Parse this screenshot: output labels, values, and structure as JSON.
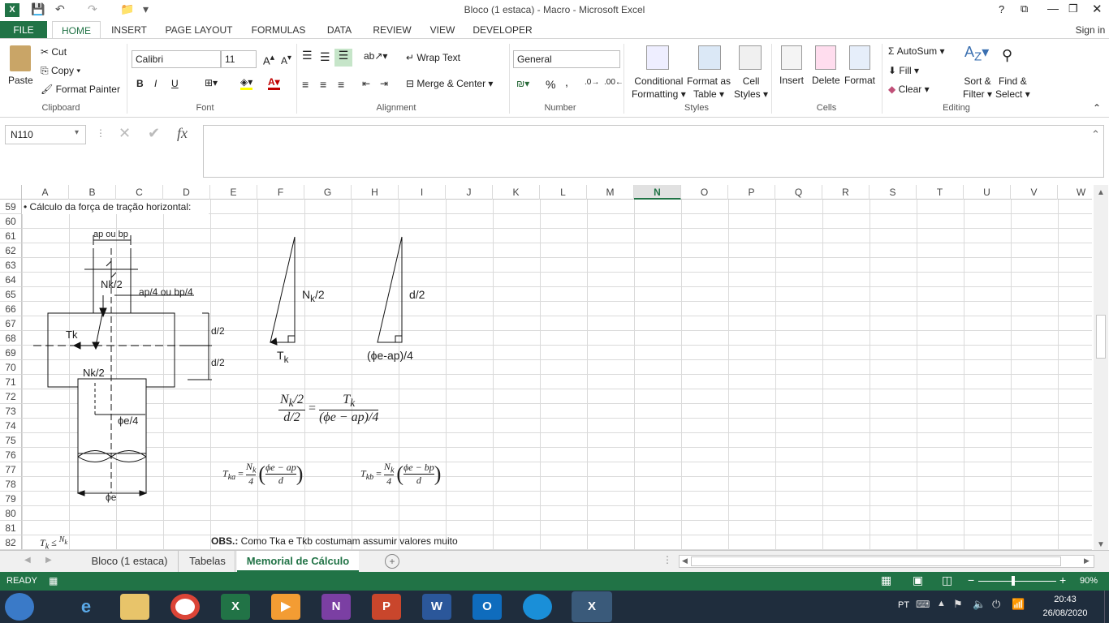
{
  "window": {
    "title": "Bloco (1 estaca) - Macro - Microsoft Excel",
    "sign_in": "Sign in"
  },
  "tabs": [
    "FILE",
    "HOME",
    "INSERT",
    "PAGE LAYOUT",
    "FORMULAS",
    "DATA",
    "REVIEW",
    "VIEW",
    "DEVELOPER"
  ],
  "clipboard": {
    "paste": "Paste",
    "cut": "Cut",
    "copy": "Copy",
    "format_painter": "Format Painter",
    "label": "Clipboard"
  },
  "font": {
    "name": "Calibri",
    "size": "11",
    "label": "Font",
    "bold": "B",
    "italic": "I",
    "underline": "U"
  },
  "alignment": {
    "wrap": "Wrap Text",
    "merge": "Merge & Center",
    "label": "Alignment"
  },
  "number": {
    "format": "General",
    "percent": "%",
    "comma": ",",
    "label": "Number"
  },
  "styles": {
    "conditional": "Conditional",
    "formatting": "Formatting",
    "format_as": "Format as",
    "table": "Table",
    "cell": "Cell",
    "styles": "Styles",
    "label": "Styles"
  },
  "cells": {
    "insert": "Insert",
    "delete": "Delete",
    "format": "Format",
    "label": "Cells"
  },
  "editing": {
    "autosum": "AutoSum",
    "fill": "Fill",
    "clear": "Clear",
    "sort": "Sort &",
    "filter": "Filter",
    "find": "Find &",
    "select": "Select",
    "label": "Editing"
  },
  "formula_bar": {
    "name_box": "N110",
    "fx": "fx"
  },
  "columns": [
    "A",
    "B",
    "C",
    "D",
    "E",
    "F",
    "G",
    "H",
    "I",
    "J",
    "K",
    "L",
    "M",
    "N",
    "O",
    "P",
    "Q",
    "R",
    "S",
    "T",
    "U",
    "V",
    "W"
  ],
  "selected_column": "N",
  "rows": [
    "59",
    "60",
    "61",
    "62",
    "63",
    "64",
    "65",
    "66",
    "67",
    "68",
    "69",
    "70",
    "71",
    "72",
    "73",
    "74",
    "75",
    "76",
    "77",
    "78",
    "79",
    "80",
    "81",
    "82"
  ],
  "sheet": {
    "heading": "• Cálculo da força de tração horizontal:",
    "ap_bp": "ap ou bp",
    "nk2": "Nk/2",
    "ap4": "ap/4 ou bp/4",
    "tk": "Tk",
    "d2": "d/2",
    "phie4": "ϕe/4",
    "phie": "ϕe",
    "tri1_side": "N",
    "tri1_sub": "k",
    "tri1_over": "/2",
    "tri1_base": "T",
    "tri1_base_sub": "k",
    "tri2_side": "d/2",
    "tri2_base": "(ϕe-ap)/4",
    "obs_bold": "OBS.:",
    "obs_text": " Como Tka e Tkb costumam assumir valores muito"
  },
  "sheet_tabs": [
    "Bloco (1 estaca)",
    "Tabelas",
    "Memorial de Cálculo"
  ],
  "active_sheet": "Memorial de Cálculo",
  "status": {
    "ready": "READY",
    "zoom": "90%"
  },
  "taskbar": {
    "lang": "PT",
    "time": "20:43",
    "date": "26/08/2020"
  },
  "colors": {
    "excel_green": "#217346",
    "taskbar": "#1f2d3d"
  }
}
